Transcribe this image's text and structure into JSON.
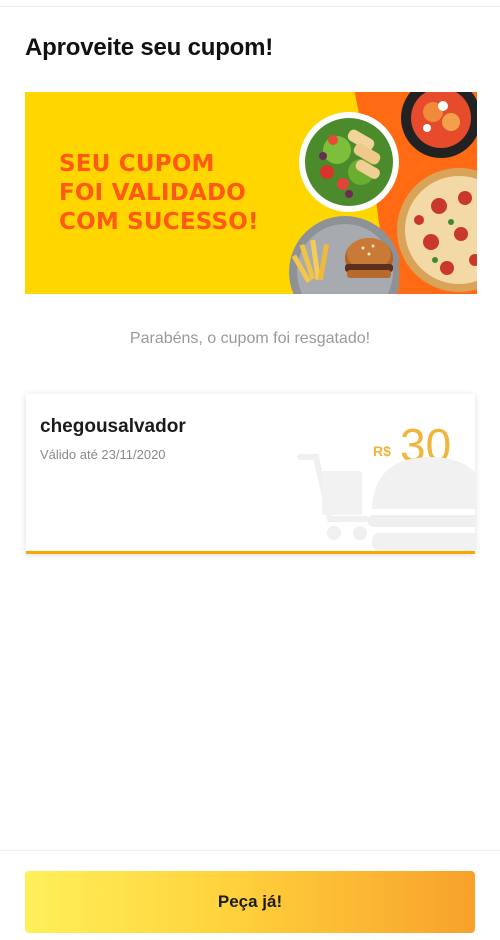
{
  "page": {
    "title": "Aproveite seu cupom!"
  },
  "banner": {
    "headline_lines": [
      "SEU CUPOM",
      "FOI VALIDADO",
      "COM SUCESSO!"
    ],
    "colors": {
      "background": "#ffd600",
      "accent": "#ff6a13",
      "text": "#ff5a14"
    },
    "images": [
      "salad-bowl",
      "pasta-bowl",
      "pizza",
      "burger-and-fries"
    ]
  },
  "message": "Parabéns, o cupom foi resgatado!",
  "coupon": {
    "code": "chegousalvador",
    "validity": "Válido até 23/11/2020",
    "currency": "R$",
    "amount": "30",
    "watermark_icon": "shopping-cart-burger-icon",
    "accent_color": "#f1b53b"
  },
  "cta": {
    "label": "Peça já!"
  }
}
